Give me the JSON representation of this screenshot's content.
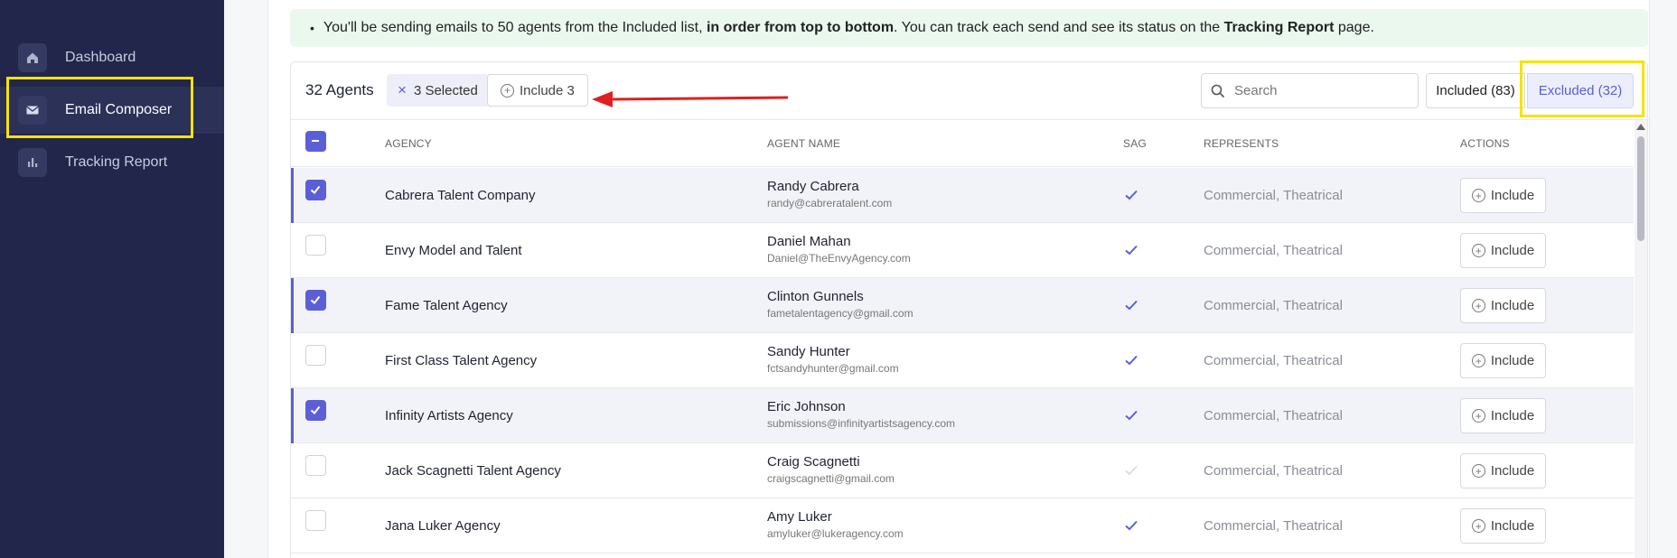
{
  "sidebar": {
    "items": [
      {
        "label": "Dashboard",
        "icon": "home-icon"
      },
      {
        "label": "Email Composer",
        "icon": "mail-icon"
      },
      {
        "label": "Tracking Report",
        "icon": "bar-chart-icon"
      }
    ]
  },
  "notice": {
    "bullet": "•",
    "part1": "You'll be sending emails to 50 agents from the Included list, ",
    "bold1": "in order from top to bottom",
    "part2": ". You can track each send and see its status on the ",
    "bold2": "Tracking Report",
    "part3": " page."
  },
  "toolbar": {
    "agents_count": "32 Agents",
    "selected_label": "3 Selected",
    "include_selected_label": "Include 3",
    "search_placeholder": "Search",
    "tab_included": "Included (83)",
    "tab_excluded": "Excluded (32)"
  },
  "table": {
    "headers": {
      "agency": "AGENCY",
      "agent_name": "AGENT NAME",
      "sag": "SAG",
      "represents": "REPRESENTS",
      "actions": "ACTIONS"
    },
    "action_label": "Include",
    "rows": [
      {
        "agency": "Cabrera Talent Company",
        "name": "Randy Cabrera",
        "email": "randy@cabreratalent.com",
        "sag": true,
        "represents": "Commercial, Theatrical",
        "selected": true
      },
      {
        "agency": "Envy Model and Talent",
        "name": "Daniel Mahan",
        "email": "Daniel@TheEnvyAgency.com",
        "sag": true,
        "represents": "Commercial, Theatrical",
        "selected": false
      },
      {
        "agency": "Fame Talent Agency",
        "name": "Clinton Gunnels",
        "email": "fametalentagency@gmail.com",
        "sag": true,
        "represents": "Commercial, Theatrical",
        "selected": true
      },
      {
        "agency": "First Class Talent Agency",
        "name": "Sandy Hunter",
        "email": "fctsandyhunter@gmail.com",
        "sag": true,
        "represents": "Commercial, Theatrical",
        "selected": false
      },
      {
        "agency": "Infinity Artists Agency",
        "name": "Eric Johnson",
        "email": "submissions@infinityartistsagency.com",
        "sag": true,
        "represents": "Commercial, Theatrical",
        "selected": true
      },
      {
        "agency": "Jack Scagnetti Talent Agency",
        "name": "Craig Scagnetti",
        "email": "craigscagnetti@gmail.com",
        "sag": false,
        "represents": "Commercial, Theatrical",
        "selected": false
      },
      {
        "agency": "Jana Luker Agency",
        "name": "Amy Luker",
        "email": "amyluker@lukeragency.com",
        "sag": true,
        "represents": "Commercial, Theatrical",
        "selected": false
      }
    ]
  },
  "colors": {
    "accent": "#5b5fd6",
    "sidebar_bg": "#22264a",
    "highlight": "#f5e400",
    "arrow": "#e02020",
    "notice_bg": "#eaf8ee"
  }
}
